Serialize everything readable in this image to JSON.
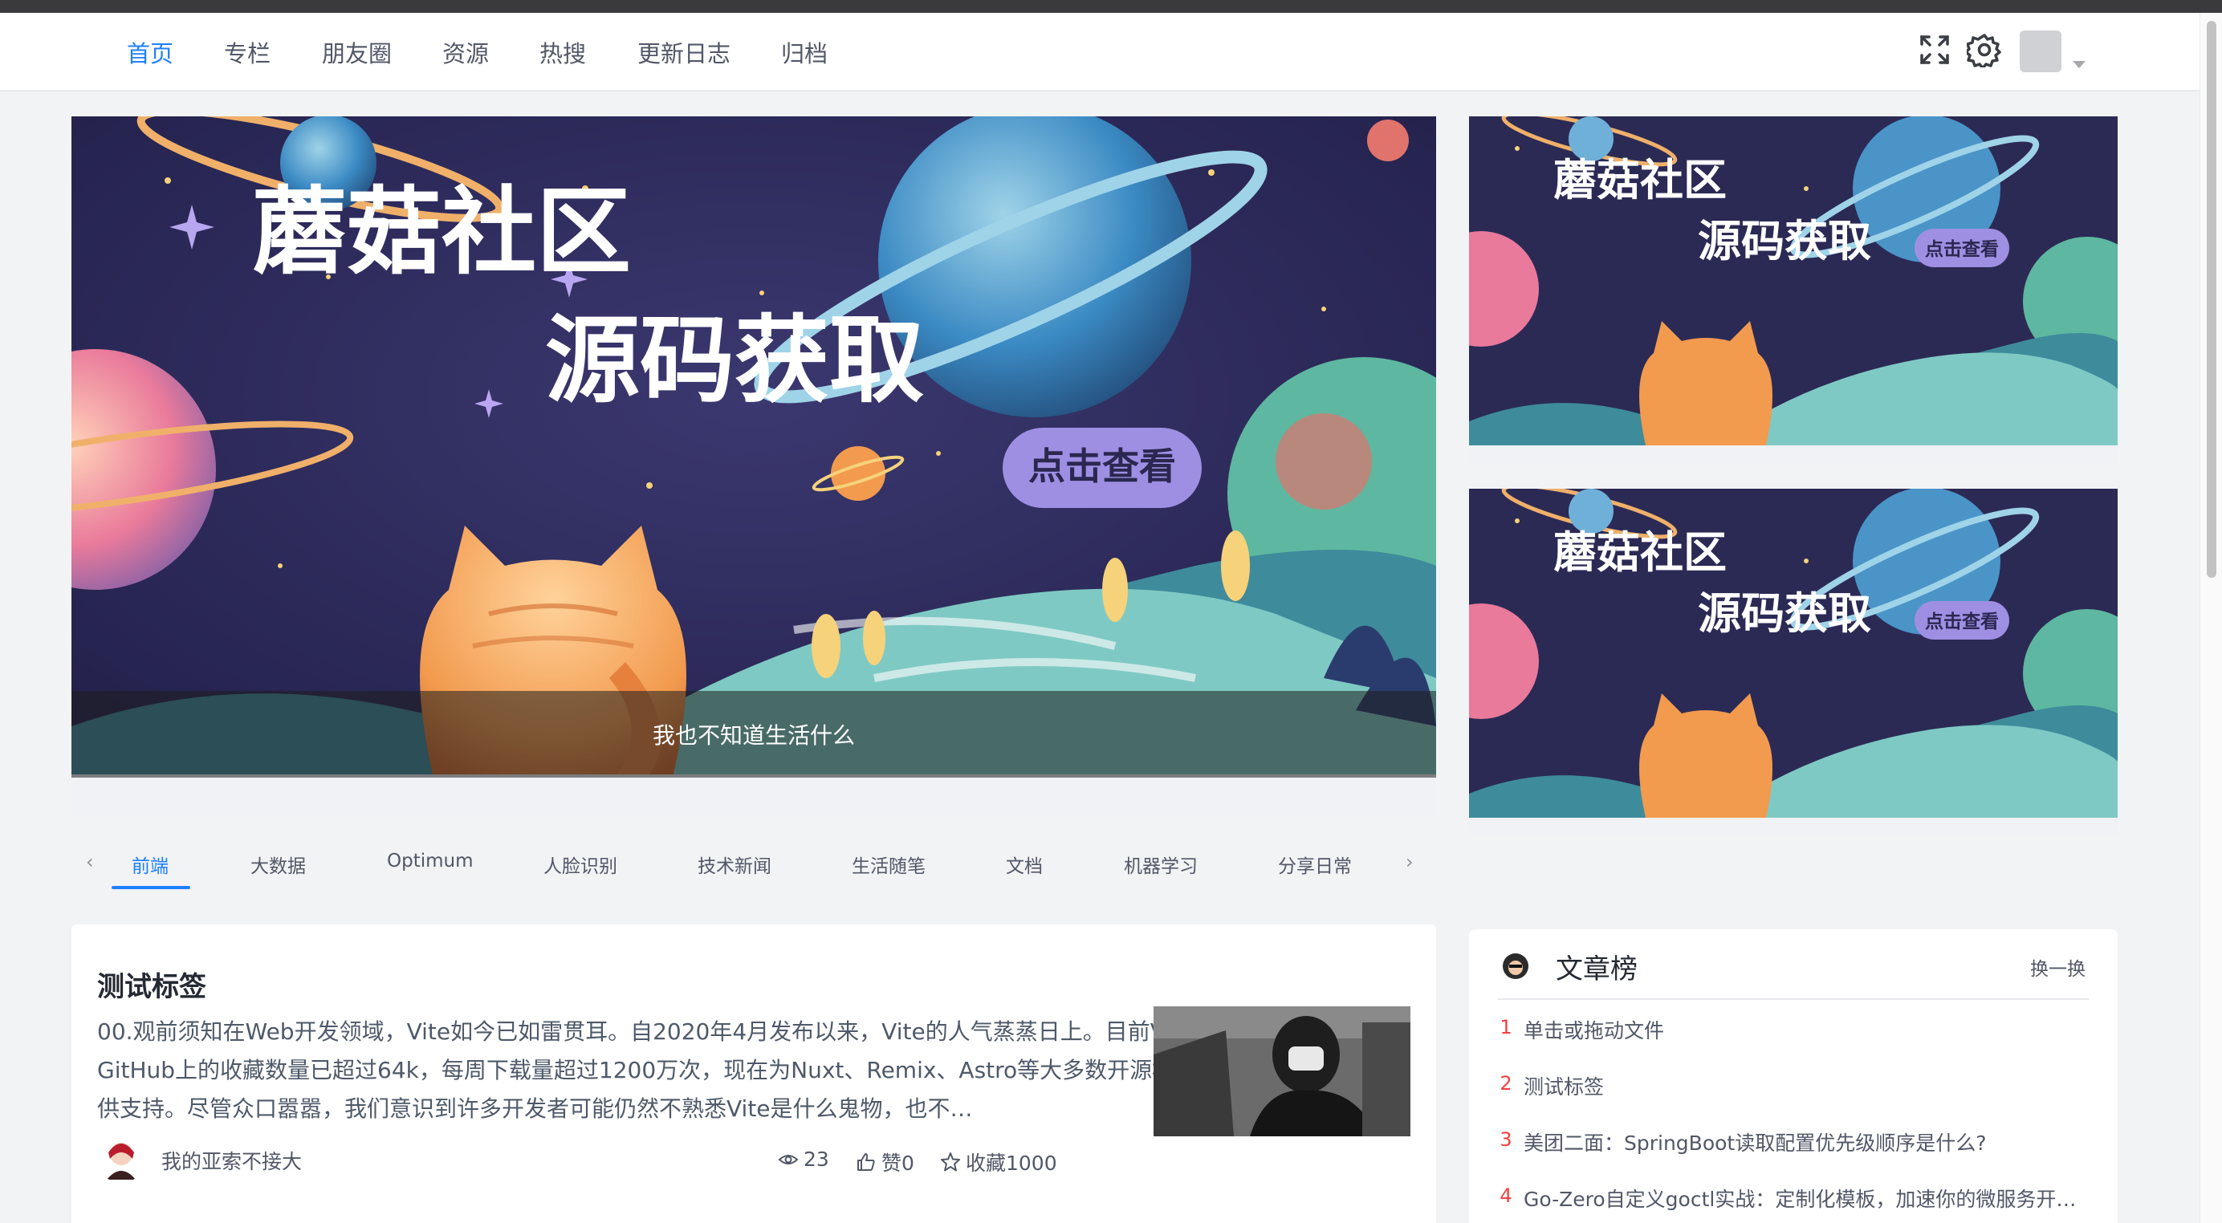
{
  "nav": {
    "items": [
      "首页",
      "专栏",
      "朋友圈",
      "资源",
      "热搜",
      "更新日志",
      "归档"
    ],
    "active_index": 0
  },
  "banner": {
    "main": {
      "title_line1": "蘑菇社区",
      "title_line2": "源码获取",
      "button": "点击查看",
      "caption": "我也不知道生活什么"
    },
    "side": [
      {
        "title_line1": "蘑菇社区",
        "title_line2": "源码获取",
        "button": "点击查看"
      },
      {
        "title_line1": "蘑菇社区",
        "title_line2": "源码获取",
        "button": "点击查看"
      }
    ]
  },
  "categories": {
    "items": [
      "前端",
      "大数据",
      "Optimum",
      "人脸识别",
      "技术新闻",
      "生活随笔",
      "文档",
      "机器学习",
      "分享日常"
    ],
    "active_index": 0,
    "prev_arrow": "‹",
    "next_arrow": "›"
  },
  "article": {
    "title": "测试标签",
    "summary": "00.观前须知在Web开发领域，Vite如今已如雷贯耳。自2020年4月发布以来，Vite的人气蒸蒸日上。目前Vite在GitHub上的收藏数量已超过64k，每周下载量超过1200万次，现在为Nuxt、Remix、Astro等大多数开源框架提供支持。尽管众口嚣嚣，我们意识到许多开发者可能仍然不熟悉Vite是什么鬼物，也不…",
    "author": "我的亚索不接大",
    "views": "23",
    "likes": "赞0",
    "favorites": "收藏1000"
  },
  "rank": {
    "title": "文章榜",
    "refresh": "换一换",
    "items": [
      {
        "num": "1",
        "text": "单击或拖动文件"
      },
      {
        "num": "2",
        "text": "测试标签"
      },
      {
        "num": "3",
        "text": "美团二面：SpringBoot读取配置优先级顺序是什么?"
      },
      {
        "num": "4",
        "text": "Go-Zero自定义goctl实战：定制化模板，加速你的微服务开…"
      }
    ]
  }
}
